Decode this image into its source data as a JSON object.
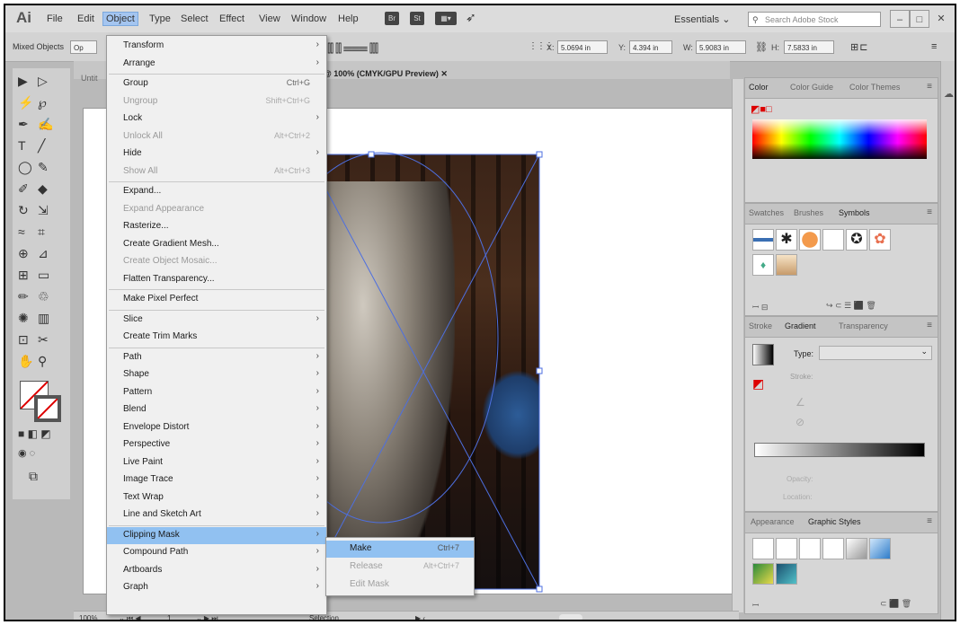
{
  "app": {
    "logo": "Ai"
  },
  "menubar": {
    "items": [
      "File",
      "Edit",
      "Object",
      "Type",
      "Select",
      "Effect",
      "View",
      "Window",
      "Help"
    ],
    "bridge": "Br",
    "stock": "St",
    "workspace": "Essentials",
    "search_placeholder": "Search Adobe Stock"
  },
  "control": {
    "selection": "Mixed Objects",
    "x_label": "X:",
    "x_value": "5.0694 in",
    "y_label": "Y:",
    "y_value": "4.394 in",
    "w_label": "W:",
    "w_value": "5.9083 in",
    "h_label": "H:",
    "h_value": "7.5833 in"
  },
  "document": {
    "tab_title": "@ 100% (CMYK/GPU Preview)",
    "untitled": "Untit",
    "zoom": "100%",
    "page": "1",
    "status": "Selection"
  },
  "object_menu": [
    {
      "label": "Transform",
      "submenu": true
    },
    {
      "label": "Arrange",
      "submenu": true
    },
    {
      "sep": true
    },
    {
      "label": "Group",
      "shortcut": "Ctrl+G"
    },
    {
      "label": "Ungroup",
      "shortcut": "Shift+Ctrl+G",
      "disabled": true
    },
    {
      "label": "Lock",
      "submenu": true
    },
    {
      "label": "Unlock All",
      "shortcut": "Alt+Ctrl+2",
      "disabled": true
    },
    {
      "label": "Hide",
      "submenu": true
    },
    {
      "label": "Show All",
      "shortcut": "Alt+Ctrl+3",
      "disabled": true
    },
    {
      "sep": true
    },
    {
      "label": "Expand..."
    },
    {
      "label": "Expand Appearance",
      "disabled": true
    },
    {
      "label": "Rasterize..."
    },
    {
      "label": "Create Gradient Mesh..."
    },
    {
      "label": "Create Object Mosaic...",
      "disabled": true
    },
    {
      "label": "Flatten Transparency..."
    },
    {
      "sep": true
    },
    {
      "label": "Make Pixel Perfect"
    },
    {
      "sep": true
    },
    {
      "label": "Slice",
      "submenu": true
    },
    {
      "label": "Create Trim Marks"
    },
    {
      "sep": true
    },
    {
      "label": "Path",
      "submenu": true
    },
    {
      "label": "Shape",
      "submenu": true
    },
    {
      "label": "Pattern",
      "submenu": true
    },
    {
      "label": "Blend",
      "submenu": true
    },
    {
      "label": "Envelope Distort",
      "submenu": true
    },
    {
      "label": "Perspective",
      "submenu": true
    },
    {
      "label": "Live Paint",
      "submenu": true
    },
    {
      "label": "Image Trace",
      "submenu": true
    },
    {
      "label": "Text Wrap",
      "submenu": true
    },
    {
      "label": "Line and Sketch Art",
      "submenu": true
    },
    {
      "sep": true
    },
    {
      "label": "Clipping Mask",
      "submenu": true,
      "highlighted": true
    },
    {
      "label": "Compound Path",
      "submenu": true
    },
    {
      "label": "Artboards",
      "submenu": true
    },
    {
      "label": "Graph",
      "submenu": true
    }
  ],
  "clipping_submenu": [
    {
      "label": "Make",
      "shortcut": "Ctrl+7",
      "highlighted": true
    },
    {
      "label": "Release",
      "shortcut": "Alt+Ctrl+7",
      "disabled": true
    },
    {
      "label": "Edit Mask",
      "disabled": true
    }
  ],
  "panels": {
    "color_tabs": [
      "Color",
      "Color Guide",
      "Color Themes"
    ],
    "swatch_tabs": [
      "Swatches",
      "Brushes",
      "Symbols"
    ],
    "gradient_tabs": [
      "Stroke",
      "Gradient",
      "Transparency"
    ],
    "gradient_type_label": "Type:",
    "gradient_stroke_label": "Stroke:",
    "opacity_label": "Opacity:",
    "location_label": "Location:",
    "styles_tabs": [
      "Appearance",
      "Graphic Styles"
    ]
  }
}
